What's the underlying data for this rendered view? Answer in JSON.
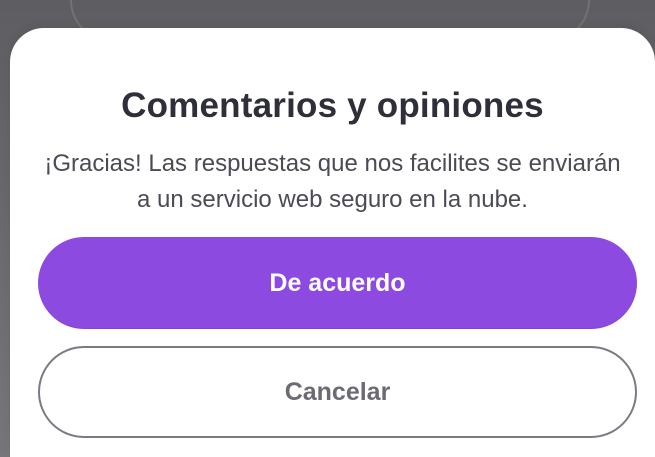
{
  "dialog": {
    "title": "Comentarios y opiniones",
    "message": "¡Gracias! Las respuestas que nos facilites se enviarán a un servicio web seguro en la nube.",
    "primary_button": "De acuerdo",
    "secondary_button": "Cancelar"
  },
  "colors": {
    "overlay": "#6f6f73",
    "sheet": "#ffffff",
    "title": "#2f2f3a",
    "body_text": "#4b4b55",
    "primary": "#8c4ae0",
    "primary_text": "#ffffff",
    "secondary_border": "#7a7a84",
    "secondary_text": "#6b6b74"
  }
}
